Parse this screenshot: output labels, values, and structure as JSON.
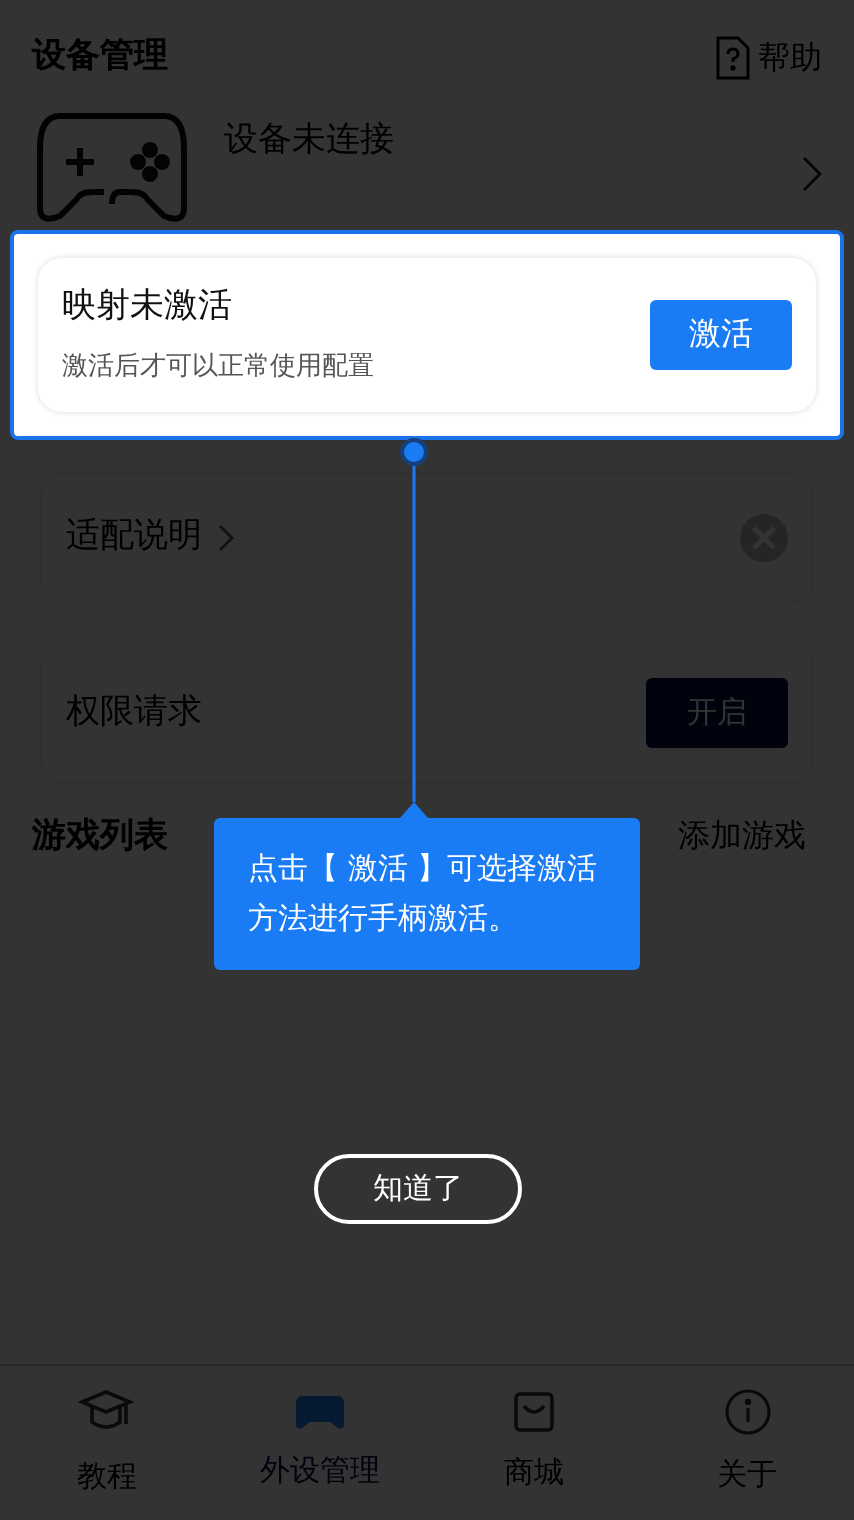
{
  "header": {
    "title": "设备管理",
    "help": "帮助"
  },
  "device": {
    "status": "设备未连接"
  },
  "activation_card": {
    "title": "映射未激活",
    "subtitle": "激活后才可以正常使用配置",
    "button": "激活"
  },
  "adapt_card": {
    "label": "适配说明"
  },
  "permission_card": {
    "label": "权限请求",
    "button": "开启"
  },
  "games": {
    "title": "游戏列表",
    "add": "添加游戏"
  },
  "tooltip": {
    "text": "点击【 激活 】可选择激活方法进行手柄激活。"
  },
  "dismiss_button": "知道了",
  "nav": [
    {
      "label": "教程",
      "selected": false
    },
    {
      "label": "外设管理",
      "selected": true
    },
    {
      "label": "商城",
      "selected": false
    },
    {
      "label": "关于",
      "selected": false
    }
  ]
}
